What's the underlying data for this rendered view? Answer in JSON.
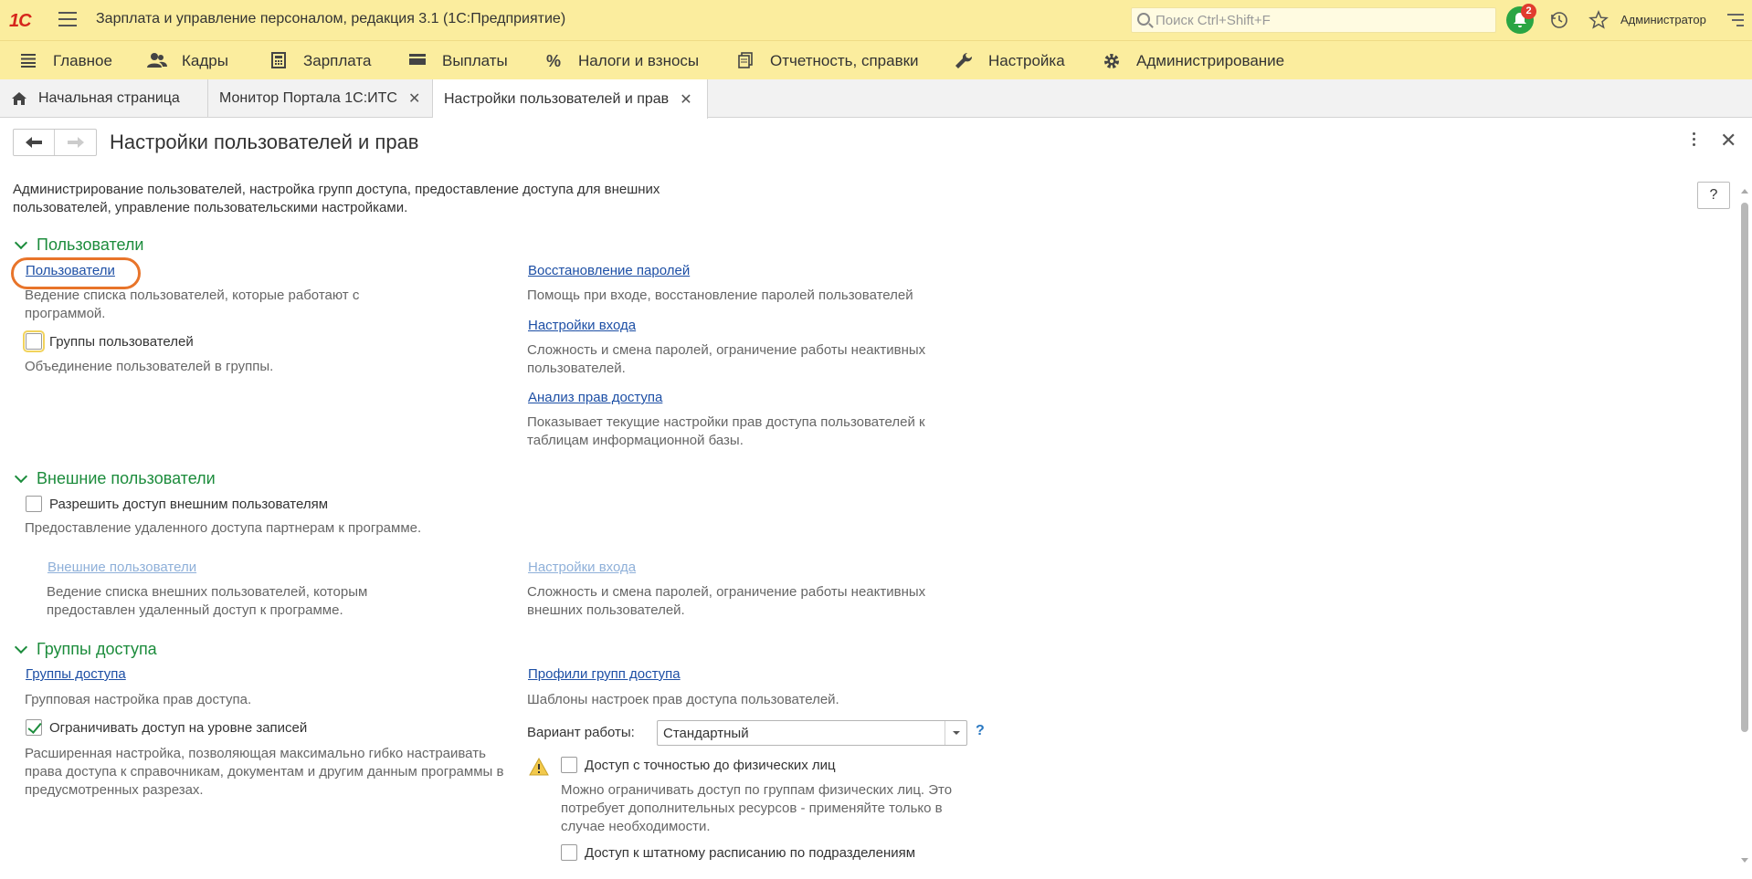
{
  "app": {
    "logo": "1С",
    "title": "Зарплата и управление персоналом, редакция 3.1  (1С:Предприятие)",
    "search_placeholder": "Поиск Ctrl+Shift+F",
    "notifications_count": "2",
    "user": "Администратор",
    "colors": {
      "bar": "#fbed9e",
      "accent_green": "#1c8c3c",
      "link": "#1d4fa5",
      "highlight": "#e8742a"
    }
  },
  "sections": [
    {
      "label": "Главное",
      "icon": "menu-lines-icon"
    },
    {
      "label": "Кадры",
      "icon": "people-icon"
    },
    {
      "label": "Зарплата",
      "icon": "calculator-icon"
    },
    {
      "label": "Выплаты",
      "icon": "wallet-icon"
    },
    {
      "label": "Налоги и взносы",
      "icon": "percent-icon"
    },
    {
      "label": "Отчетность, справки",
      "icon": "documents-icon"
    },
    {
      "label": "Настройка",
      "icon": "wrench-icon"
    },
    {
      "label": "Администрирование",
      "icon": "gear-icon"
    }
  ],
  "tabs": [
    {
      "label": "Начальная страница"
    },
    {
      "label": "Монитор Портала 1С:ИТС"
    },
    {
      "label": "Настройки пользователей и прав"
    }
  ],
  "page": {
    "title": "Настройки пользователей и прав",
    "help": "?",
    "intro": "Администрирование пользователей, настройка групп доступа, предоставление доступа для внешних пользователей, управление пользовательскими настройками.",
    "users_group": {
      "title": "Пользователи",
      "users_link": "Пользователи",
      "users_desc": "Ведение списка пользователей, которые работают с программой.",
      "user_groups_check": "Группы пользователей",
      "user_groups_desc": "Объединение пользователей в группы.",
      "password_recovery_link": "Восстановление паролей",
      "password_recovery_desc": "Помощь при входе, восстановление паролей пользователей",
      "login_settings_link": "Настройки входа",
      "login_settings_desc": "Сложность и смена паролей, ограничение работы неактивных пользователей.",
      "access_analysis_link": "Анализ прав доступа",
      "access_analysis_desc": "Показывает текущие настройки прав доступа пользователей к таблицам информационной базы."
    },
    "external_group": {
      "title": "Внешние пользователи",
      "allow_check": "Разрешить доступ внешним пользователям",
      "allow_desc": "Предоставление удаленного доступа партнерам к программе.",
      "ext_users_link": "Внешние пользователи",
      "ext_users_desc": "Ведение списка внешних пользователей, которым предоставлен удаленный доступ к программе.",
      "ext_login_link": "Настройки входа",
      "ext_login_desc": "Сложность и смена паролей, ограничение работы неактивных внешних пользователей."
    },
    "access_group": {
      "title": "Группы доступа",
      "access_groups_link": "Группы доступа",
      "access_groups_desc": "Групповая настройка прав доступа.",
      "restrict_check": "Ограничивать доступ на уровне записей",
      "restrict_desc": "Расширенная настройка, позволяющая максимально гибко настраивать права доступа к справочникам, документам и другим данным программы в предусмотренных разрезах.",
      "profiles_link": "Профили групп доступа",
      "profiles_desc": "Шаблоны настроек прав доступа пользователей.",
      "variant_label": "Вариант работы:",
      "variant_value": "Стандартный",
      "variant_help": "?",
      "persons_check": "Доступ с точностью до физических лиц",
      "persons_desc": "Можно ограничивать доступ по группам физических лиц. Это потребует дополнительных ресурсов - применяйте только в случае необходимости.",
      "staff_check": "Доступ к штатному расписанию по подразделениям"
    }
  }
}
